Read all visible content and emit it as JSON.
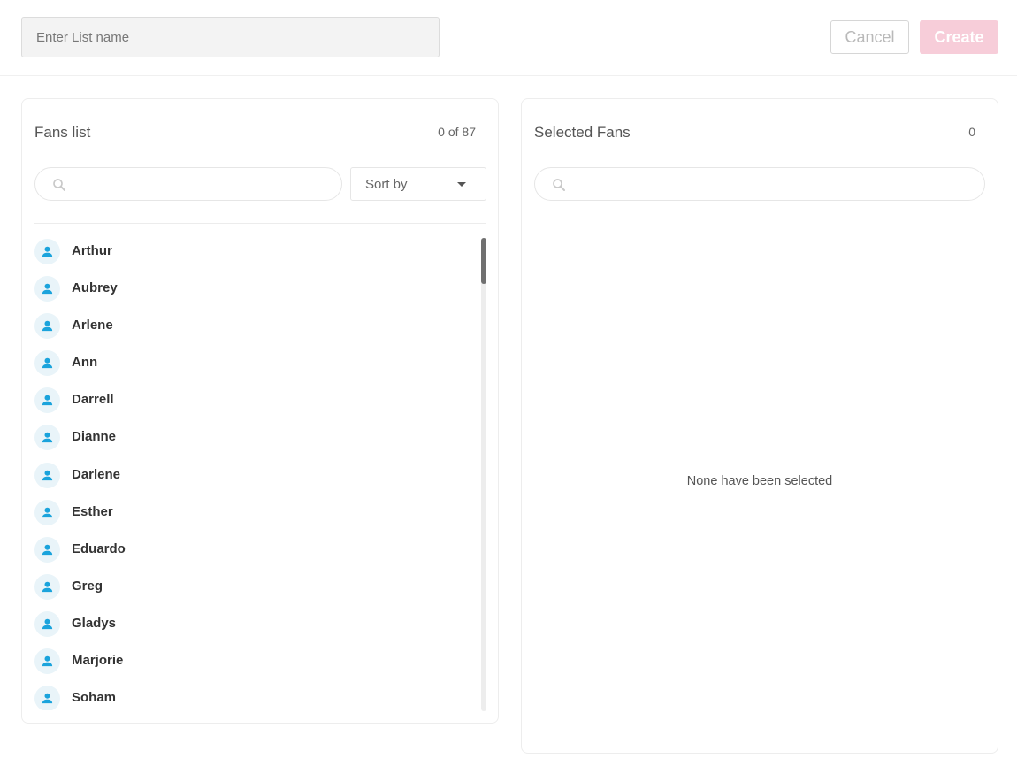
{
  "header": {
    "list_name_placeholder": "Enter List name",
    "list_name_value": "",
    "cancel_label": "Cancel",
    "create_label": "Create"
  },
  "fans_panel": {
    "title": "Fans list",
    "count": "0 of 87",
    "search_placeholder": "",
    "sort_label": "Sort by",
    "items": [
      {
        "name": "Arthur"
      },
      {
        "name": "Aubrey"
      },
      {
        "name": "Arlene"
      },
      {
        "name": "Ann"
      },
      {
        "name": "Darrell"
      },
      {
        "name": "Dianne"
      },
      {
        "name": "Darlene"
      },
      {
        "name": "Esther"
      },
      {
        "name": "Eduardo"
      },
      {
        "name": "Greg"
      },
      {
        "name": "Gladys"
      },
      {
        "name": "Marjorie"
      },
      {
        "name": "Soham"
      }
    ]
  },
  "selected_panel": {
    "title": "Selected Fans",
    "count": "0",
    "search_placeholder": "",
    "empty_message": "None have been selected"
  },
  "colors": {
    "avatar_icon": "#1aa3dc",
    "avatar_bg": "#e9f4f9",
    "create_button_disabled": "#f7cdd9"
  },
  "icons": {
    "search": "search-icon",
    "avatar": "user-icon",
    "sort_caret": "caret-down-icon"
  }
}
